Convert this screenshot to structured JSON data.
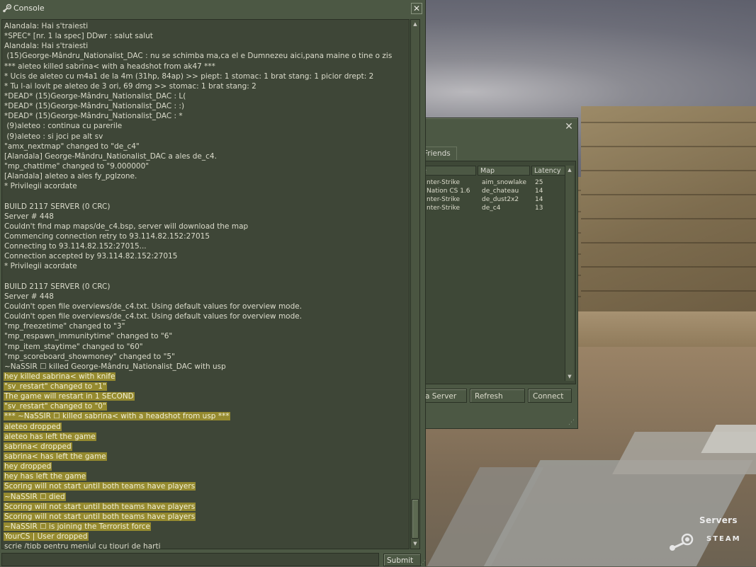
{
  "console": {
    "title": "Console",
    "close_glyph": "✕",
    "lines": [
      {
        "text": "Alandala: Hai s'traiesti",
        "hl": false
      },
      {
        "text": "*SPEC* [nr. 1 la spec] DDwr : salut salut",
        "hl": false
      },
      {
        "text": "Alandala: Hai s'traiesti",
        "hl": false
      },
      {
        "text": " (15)George-Mândru_Nationalist_DAC : nu se schimba ma,ca el e Dumnezeu aici,pana maine o tine o zis",
        "hl": false
      },
      {
        "text": "*** aleteo killed sabrina< with a headshot from ak47 ***",
        "hl": false
      },
      {
        "text": "* Ucis de aleteo cu m4a1 de la 4m (31hp, 84ap) >> piept: 1 stomac: 1 brat stang: 1 picior drept: 2",
        "hl": false
      },
      {
        "text": "* Tu l-ai lovit pe aleteo de 3 ori, 69 dmg >> stomac: 1 brat stang: 2",
        "hl": false
      },
      {
        "text": "*DEAD* (15)George-Mândru_Nationalist_DAC : L(",
        "hl": false
      },
      {
        "text": "*DEAD* (15)George-Mândru_Nationalist_DAC : :)",
        "hl": false
      },
      {
        "text": "*DEAD* (15)George-Mândru_Nationalist_DAC : *",
        "hl": false
      },
      {
        "text": " (9)aleteo : continua cu parerile",
        "hl": false
      },
      {
        "text": " (9)aleteo : si joci pe alt sv",
        "hl": false
      },
      {
        "text": "\"amx_nextmap\" changed to \"de_c4\"",
        "hl": false
      },
      {
        "text": "[Alandala] George-Mândru_Nationalist_DAC a ales de_c4.",
        "hl": false
      },
      {
        "text": "\"mp_chattime\" changed to \"9.000000\"",
        "hl": false
      },
      {
        "text": "[Alandala] aleteo a ales fy_pglzone.",
        "hl": false
      },
      {
        "text": "* Privilegii acordate",
        "hl": false
      },
      {
        "text": "",
        "hl": false
      },
      {
        "text": "BUILD 2117 SERVER (0 CRC)",
        "hl": false
      },
      {
        "text": "Server # 448",
        "hl": false
      },
      {
        "text": "Couldn't find map maps/de_c4.bsp, server will download the map",
        "hl": false
      },
      {
        "text": "Commencing connection retry to 93.114.82.152:27015",
        "hl": false
      },
      {
        "text": "Connecting to 93.114.82.152:27015...",
        "hl": false
      },
      {
        "text": "Connection accepted by 93.114.82.152:27015",
        "hl": false
      },
      {
        "text": "* Privilegii acordate",
        "hl": false
      },
      {
        "text": "",
        "hl": false
      },
      {
        "text": "BUILD 2117 SERVER (0 CRC)",
        "hl": false
      },
      {
        "text": "Server # 448",
        "hl": false
      },
      {
        "text": "Couldn't open file overviews/de_c4.txt. Using default values for overview mode.",
        "hl": false
      },
      {
        "text": "Couldn't open file overviews/de_c4.txt. Using default values for overview mode.",
        "hl": false
      },
      {
        "text": "\"mp_freezetime\" changed to \"3\"",
        "hl": false
      },
      {
        "text": "\"mp_respawn_immunitytime\" changed to \"6\"",
        "hl": false
      },
      {
        "text": "\"mp_item_staytime\" changed to \"60\"",
        "hl": false
      },
      {
        "text": "\"mp_scoreboard_showmoney\" changed to \"5\"",
        "hl": false
      },
      {
        "text": "~NaSSIR ☐ killed George-Mândru_Nationalist_DAC with usp",
        "hl": false
      },
      {
        "text": "hey killed sabrina< with knife",
        "hl": true
      },
      {
        "text": "\"sv_restart\" changed to \"1\"",
        "hl": true
      },
      {
        "text": "The game will restart in 1 SECOND",
        "hl": true
      },
      {
        "text": "\"sv_restart\" changed to \"0\"",
        "hl": true
      },
      {
        "text": "*** ~NaSSIR ☐ killed sabrina< with a headshot from usp ***",
        "hl": true
      },
      {
        "text": "aleteo dropped",
        "hl": true
      },
      {
        "text": "aleteo has left the game",
        "hl": true
      },
      {
        "text": "sabrina< dropped",
        "hl": true
      },
      {
        "text": "sabrina< has left the game",
        "hl": true
      },
      {
        "text": "hey dropped",
        "hl": true
      },
      {
        "text": "hey has left the game",
        "hl": true
      },
      {
        "text": "Scoring will not start until both teams have players",
        "hl": true
      },
      {
        "text": "~NaSSIR ☐ died",
        "hl": true
      },
      {
        "text": "Scoring will not start until both teams have players",
        "hl": true
      },
      {
        "text": "Scoring will not start until both teams have players",
        "hl": true
      },
      {
        "text": "~NaSSIR ☐ is joining the Terrorist force",
        "hl": true
      },
      {
        "text": "YourCS | User dropped",
        "hl": true
      },
      {
        "text": "scrie /tipb pentru meniul cu tipuri de harti",
        "hl": false
      }
    ],
    "input": {
      "value": "",
      "placeholder": ""
    },
    "submit_label": "Submit"
  },
  "server_browser": {
    "close_glyph": "✕",
    "tabs": [
      {
        "label": "Friends"
      }
    ],
    "columns": [
      {
        "label": "e"
      },
      {
        "label": "Map"
      },
      {
        "label": "Latency"
      }
    ],
    "rows": [
      {
        "game": "nter-Strike",
        "map": "aim_snowlake",
        "latency": "25"
      },
      {
        "game": "Nation CS 1.6",
        "map": "de_chateau",
        "latency": "14"
      },
      {
        "game": "nter-Strike",
        "map": "de_dust2x2",
        "latency": "14"
      },
      {
        "game": "nter-Strike",
        "map": "de_c4",
        "latency": "13"
      }
    ],
    "buttons": {
      "add_server": "a Server",
      "refresh": "Refresh",
      "connect": "Connect"
    }
  },
  "branding": {
    "servers_label": "Servers",
    "steam_wordmark": "STEAM"
  },
  "colors": {
    "panel": "#4c5844",
    "console_bg": "#3e4637",
    "highlight": "#958a2f"
  }
}
